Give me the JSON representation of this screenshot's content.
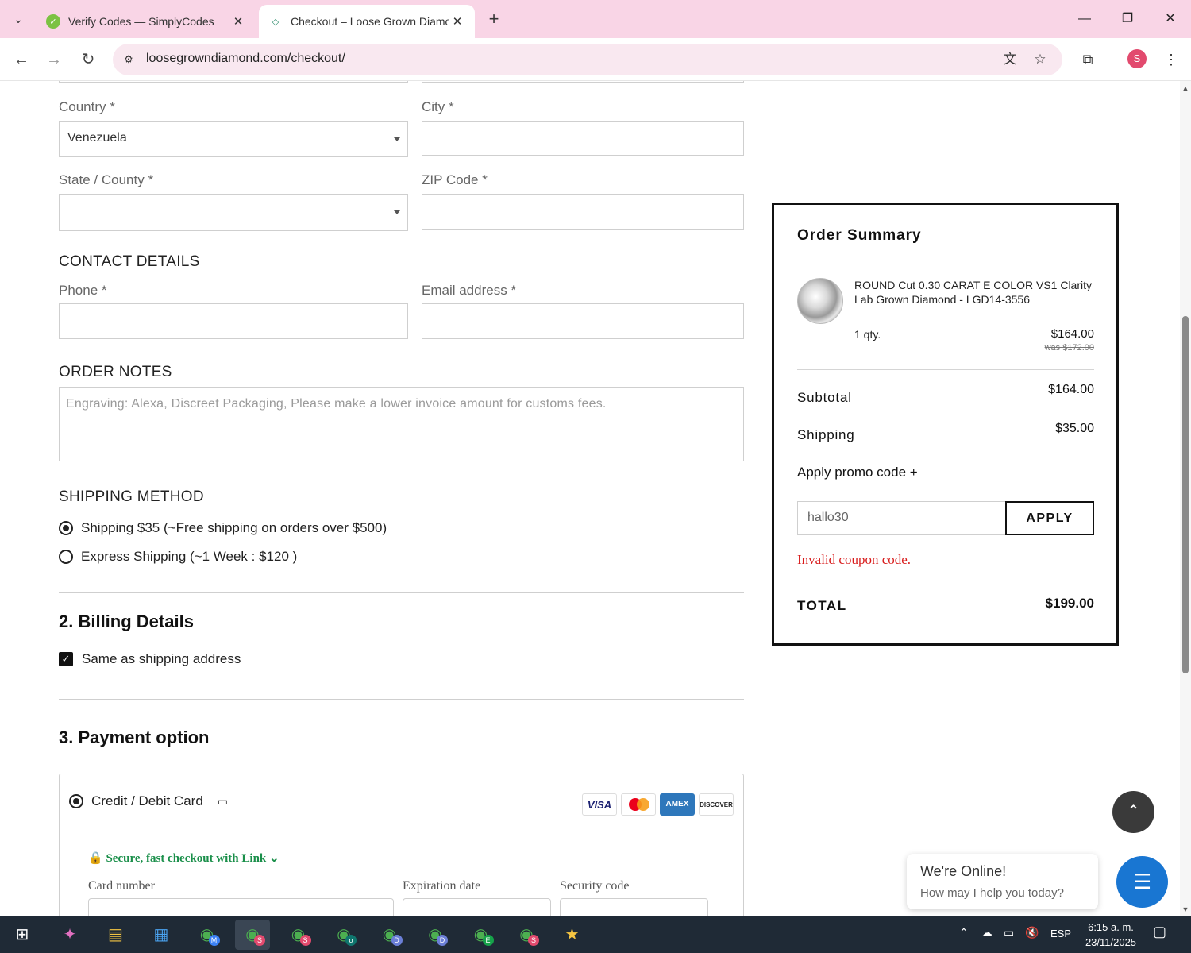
{
  "browser": {
    "tabs": [
      {
        "title": "Verify Codes — SimplyCodes",
        "icon": "simplycodes-favicon"
      },
      {
        "title": "Checkout – Loose Grown Diamo",
        "icon": "diamond-favicon"
      }
    ],
    "url": "loosegrowndiamond.com/checkout/",
    "profile_initial": "S"
  },
  "shipping_form": {
    "country_label": "Country *",
    "country_value": "Venezuela",
    "city_label": "City *",
    "state_label": "State / County *",
    "zip_label": "ZIP Code *",
    "contact_heading": "CONTACT DETAILS",
    "phone_label": "Phone *",
    "email_label": "Email address *",
    "notes_heading": "ORDER NOTES",
    "notes_placeholder": "Engraving: Alexa, Discreet Packaging, Please make a lower invoice amount for customs fees.",
    "shipping_method_heading": "SHIPPING METHOD",
    "shipping_options": [
      {
        "label": "Shipping $35 (~Free shipping on orders over $500)",
        "selected": true
      },
      {
        "label": "Express Shipping (~1 Week : $120 )",
        "selected": false
      }
    ]
  },
  "billing": {
    "heading": "2. Billing Details",
    "same_as_shipping_label": "Same as shipping address",
    "same_as_shipping_checked": true
  },
  "payment": {
    "heading": "3. Payment option",
    "option_label": "Credit / Debit Card",
    "brands": [
      "VISA",
      "mastercard",
      "AMEX",
      "DISCOVER"
    ],
    "link_text": "Secure, fast checkout with Link",
    "card_number_label": "Card number",
    "expiration_label": "Expiration date",
    "security_label": "Security code"
  },
  "order_summary": {
    "title": "Order Summary",
    "product_name": "ROUND Cut 0.30 CARAT E COLOR VS1 Clarity Lab Grown Diamond - LGD14-3556",
    "qty": "1 qty.",
    "price": "$164.00",
    "was_price": "was $172.00",
    "subtotal_label": "Subtotal",
    "subtotal_value": "$164.00",
    "shipping_label": "Shipping",
    "shipping_value": "$35.00",
    "promo_label": "Apply promo code +",
    "promo_value": "hallo30",
    "apply_label": "APPLY",
    "promo_error": "Invalid coupon code.",
    "total_label": "TOTAL",
    "total_value": "$199.00"
  },
  "chat": {
    "title": "We're Online!",
    "subtitle": "How may I help you today?"
  },
  "taskbar": {
    "language": "ESP",
    "time": "6:15 a. m.",
    "date": "23/11/2025",
    "apps": [
      {
        "icon": "copilot-icon",
        "badge": ""
      },
      {
        "icon": "file-explorer-icon",
        "badge": ""
      },
      {
        "icon": "store-icon",
        "badge": ""
      },
      {
        "icon": "chrome-icon",
        "badge": "M"
      },
      {
        "icon": "chrome-icon",
        "badge": "S"
      },
      {
        "icon": "chrome-icon",
        "badge": "S"
      },
      {
        "icon": "chrome-icon",
        "badge": "o"
      },
      {
        "icon": "chrome-icon",
        "badge": "D"
      },
      {
        "icon": "chrome-icon",
        "badge": "D"
      },
      {
        "icon": "chrome-icon",
        "badge": "E"
      },
      {
        "icon": "chrome-icon",
        "badge": "S"
      },
      {
        "icon": "star-app-icon",
        "badge": ""
      }
    ]
  },
  "colors": {
    "tabbar_bg": "#f9d5e6",
    "error_red": "#d81b1b",
    "link_green": "#1a8f4a",
    "chat_blue": "#1976d2",
    "taskbar_bg": "#1f2a36"
  }
}
